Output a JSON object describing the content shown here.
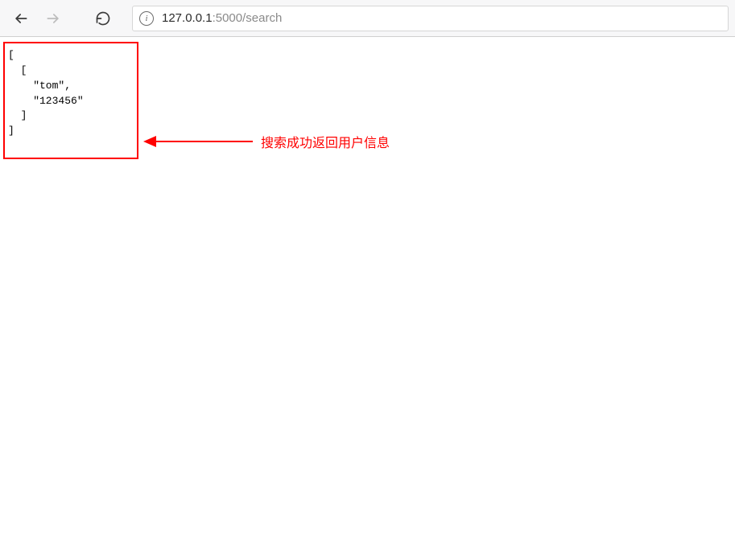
{
  "toolbar": {
    "info_glyph": "i"
  },
  "url": {
    "host": "127.0.0.1",
    "rest": ":5000/search"
  },
  "response": {
    "line1": "[",
    "line2": "  [",
    "line3": "    \"tom\",",
    "line4": "    \"123456\"",
    "line5": "  ]",
    "line6": "]"
  },
  "annotation": {
    "label": "搜索成功返回用户信息"
  }
}
